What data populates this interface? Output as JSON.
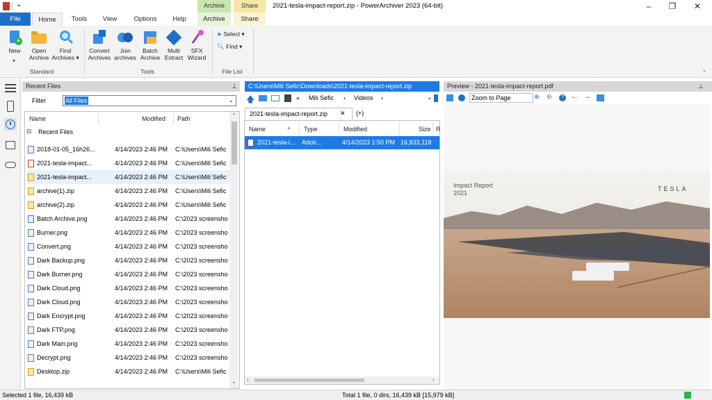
{
  "window": {
    "title": "2021-tesla-impact-report.zip - PowerArchiver 2023 (64-bit)",
    "controls": [
      "minimize",
      "maximize",
      "close"
    ]
  },
  "context_groups": [
    {
      "label": "Archive",
      "tab": "Archive",
      "color": "#c8e6b0"
    },
    {
      "label": "Share",
      "tab": "Share",
      "color": "#f6e6a6"
    }
  ],
  "tabs": [
    "File",
    "Home",
    "Tools",
    "View",
    "Options",
    "Help"
  ],
  "ribbon": {
    "standard": {
      "label": "Standard",
      "buttons": [
        {
          "line1": "New",
          "line2": "",
          "icon": "new-archive-icon"
        },
        {
          "line1": "Open",
          "line2": "Archive",
          "icon": "open-folder-icon"
        },
        {
          "line1": "Find",
          "line2": "Archives ▾",
          "icon": "find-archives-icon"
        }
      ]
    },
    "tools": {
      "label": "Tools",
      "buttons": [
        {
          "line1": "Convert",
          "line2": "Archives",
          "icon": "convert-icon"
        },
        {
          "line1": "Join",
          "line2": "archives",
          "icon": "join-icon"
        },
        {
          "line1": "Batch",
          "line2": "Archive",
          "icon": "batch-icon"
        },
        {
          "line1": "Multi",
          "line2": "Extract",
          "icon": "multi-extract-icon"
        },
        {
          "line1": "SFX",
          "line2": "Wizard",
          "icon": "sfx-wizard-icon"
        }
      ]
    },
    "file_list": {
      "label": "File List",
      "select": "Select ▾",
      "find": "Find ▾"
    }
  },
  "recent_panel": {
    "header": "Recent Files",
    "filter_label": "Filter",
    "filter_value": "All Files",
    "columns": [
      "Name",
      "Modified",
      "Path"
    ],
    "group_label": "Recent Files",
    "rows": [
      {
        "name": "2018-01-05_16h26...",
        "modified": "4/14/2023 2:46 PM",
        "path": "C:\\Users\\Mili Sefic",
        "type": "image"
      },
      {
        "name": "2021-tesla-impact...",
        "modified": "4/14/2023 2:46 PM",
        "path": "C:\\Users\\Mili Sefic",
        "type": "pdf"
      },
      {
        "name": "2021-tesla-impact...",
        "modified": "4/14/2023 2:46 PM",
        "path": "C:\\Users\\Mili Sefic",
        "type": "zip"
      },
      {
        "name": "archive(1).zip",
        "modified": "4/14/2023 2:46 PM",
        "path": "C:\\Users\\Mili Sefic",
        "type": "zip"
      },
      {
        "name": "archive(2).zip",
        "modified": "4/14/2023 2:46 PM",
        "path": "C:\\Users\\Mili Sefic",
        "type": "zip"
      },
      {
        "name": "Batch Archive.png",
        "modified": "4/14/2023 2:46 PM",
        "path": "C:\\2023 screensho",
        "type": "image"
      },
      {
        "name": "Burner.png",
        "modified": "4/14/2023 2:46 PM",
        "path": "C:\\2023 screensho",
        "type": "image"
      },
      {
        "name": "Convert.png",
        "modified": "4/14/2023 2:46 PM",
        "path": "C:\\2023 screensho",
        "type": "image"
      },
      {
        "name": "Dark Backup.png",
        "modified": "4/14/2023 2:46 PM",
        "path": "C:\\2023 screensho",
        "type": "image"
      },
      {
        "name": "Dark Burner.png",
        "modified": "4/14/2023 2:46 PM",
        "path": "C:\\2023 screensho",
        "type": "image"
      },
      {
        "name": "Dark Cloud.png",
        "modified": "4/14/2023 2:46 PM",
        "path": "C:\\2023 screensho",
        "type": "image"
      },
      {
        "name": "Dark Cloud.png",
        "modified": "4/14/2023 2:46 PM",
        "path": "C:\\2023 screensho",
        "type": "image"
      },
      {
        "name": "Dark Encrypt.png",
        "modified": "4/14/2023 2:46 PM",
        "path": "C:\\2023 screensho",
        "type": "image"
      },
      {
        "name": "Dark FTP.png",
        "modified": "4/14/2023 2:46 PM",
        "path": "C:\\2023 screensho",
        "type": "image"
      },
      {
        "name": "Dark Main.png",
        "modified": "4/14/2023 2:46 PM",
        "path": "C:\\2023 screensho",
        "type": "image"
      },
      {
        "name": "Decrypt.png",
        "modified": "4/14/2023 2:46 PM",
        "path": "C:\\2023 screensho",
        "type": "image"
      },
      {
        "name": "Desktop.zip",
        "modified": "4/14/2023 2:46 PM",
        "path": "C:\\Users\\Mili Sefic",
        "type": "zip"
      }
    ]
  },
  "archive_panel": {
    "path_header": "C:\\Users\\Mili Sefic\\Downloads\\2021-tesla-impact-report.zip",
    "breadcrumb": [
      "«",
      "Mili Sefic",
      "›",
      "Videos",
      "›"
    ],
    "tab_label": "2021-tesla-impact-report.zip",
    "tab_close": "✕",
    "add_tab": "(+)",
    "columns": [
      "Name",
      "Type",
      "Modified",
      "Size",
      "R"
    ],
    "rows": [
      {
        "name": "2021-tesla-i...",
        "type": "Adob...",
        "modified": "4/14/2023 1:50 PM",
        "size": "16,833,118"
      }
    ]
  },
  "preview_panel": {
    "header": "Preview - 2021-tesla-impact-report.pdf",
    "zoom": "Zoom to Page",
    "image_title_line1": "Impact Report",
    "image_title_line2": "2021",
    "image_brand": "TESLA"
  },
  "status": {
    "left": "Selected 1 file, 16,439 kB",
    "right": "Total 1 file, 0 dirs, 16,439 kB [15,979 kB]",
    "indicator_color": "#2fb24c"
  },
  "colors": {
    "accent": "#1e6fc7",
    "selection": "#1e7be6",
    "ribbon_bg": "#f3f3f3"
  }
}
